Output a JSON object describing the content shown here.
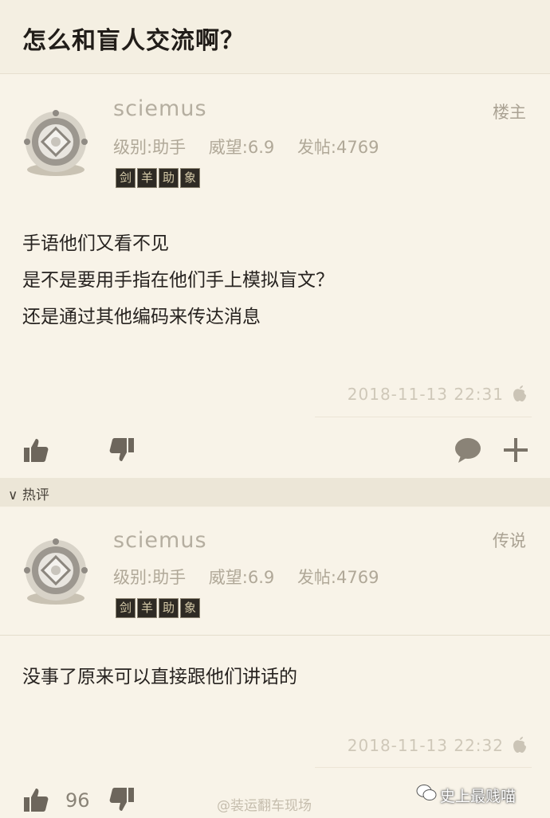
{
  "thread": {
    "title": "怎么和盲人交流啊？"
  },
  "post1": {
    "username": "sciemus",
    "level": "级别:助手",
    "prestige": "威望:6.9",
    "posts": "发帖:4769",
    "floor": "楼主",
    "lines": [
      "手语他们又看不见",
      "是不是要用手指在他们手上模拟盲文？",
      "还是通过其他编码来传达消息"
    ],
    "timestamp": "2018-11-13 22:31",
    "badges": [
      "剑",
      "羊",
      "助",
      "象"
    ]
  },
  "hot_section": {
    "label": "热评",
    "chevron": "∨"
  },
  "post2": {
    "username": "sciemus",
    "level": "级别:助手",
    "prestige": "威望:6.9",
    "posts": "发帖:4769",
    "floor": "传说",
    "lines": [
      "没事了原来可以直接跟他们讲话的"
    ],
    "timestamp": "2018-11-13 22:32",
    "like_count": "96",
    "badges": [
      "剑",
      "羊",
      "助",
      "象"
    ]
  },
  "watermark": {
    "weibo": "@装运翻车现场",
    "wechat": "史上最贱喵"
  },
  "icons": {
    "avatar": "diving-helmet-icon",
    "like": "thumbs-up-icon",
    "dislike": "thumbs-down-icon",
    "comment": "speech-bubble-icon",
    "add": "plus-icon",
    "platform": "apple-icon"
  }
}
